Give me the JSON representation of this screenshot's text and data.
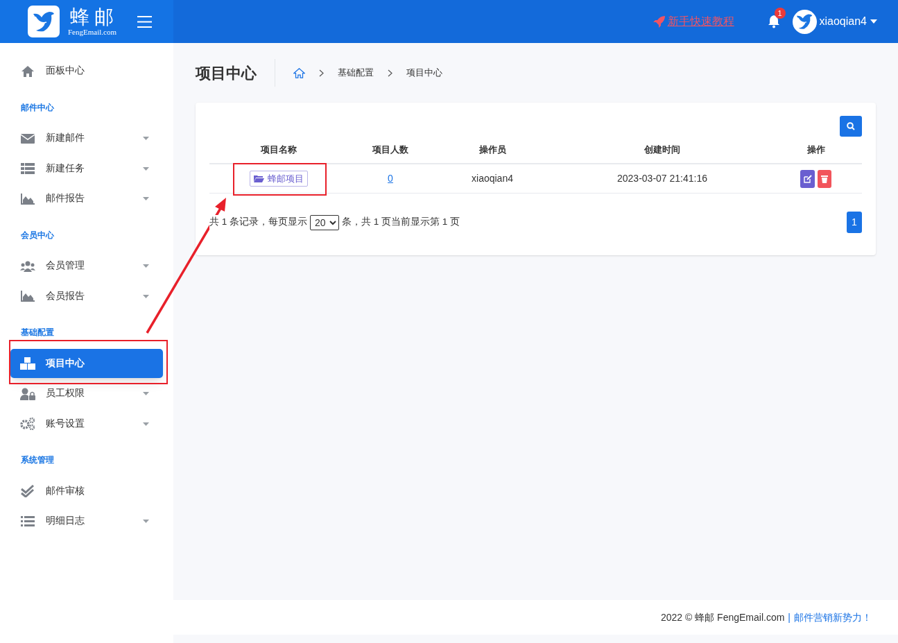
{
  "header": {
    "brand": "蜂 邮",
    "brand_sub": "FengEmail.com",
    "tutorial_link": "新手快速教程",
    "notification_count": "1",
    "username": "xiaoqian4"
  },
  "sidebar": [
    {
      "kind": "item",
      "label": "面板中心",
      "selected": false,
      "has_caret": false
    },
    {
      "kind": "section",
      "label": "邮件中心"
    },
    {
      "kind": "item",
      "label": "新建邮件",
      "selected": false,
      "has_caret": true
    },
    {
      "kind": "item",
      "label": "新建任务",
      "selected": false,
      "has_caret": true
    },
    {
      "kind": "item",
      "label": "邮件报告",
      "selected": false,
      "has_caret": true
    },
    {
      "kind": "section",
      "label": "会员中心"
    },
    {
      "kind": "item",
      "label": "会员管理",
      "selected": false,
      "has_caret": true
    },
    {
      "kind": "item",
      "label": "会员报告",
      "selected": false,
      "has_caret": true
    },
    {
      "kind": "section",
      "label": "基础配置"
    },
    {
      "kind": "item",
      "label": "项目中心",
      "selected": true,
      "has_caret": false
    },
    {
      "kind": "item",
      "label": "员工权限",
      "selected": false,
      "has_caret": true
    },
    {
      "kind": "item",
      "label": "账号设置",
      "selected": false,
      "has_caret": true
    },
    {
      "kind": "section",
      "label": "系统管理"
    },
    {
      "kind": "item",
      "label": "邮件审核",
      "selected": false,
      "has_caret": false
    },
    {
      "kind": "item",
      "label": "明细日志",
      "selected": false,
      "has_caret": true
    }
  ],
  "page_title": "项目中心",
  "breadcrumb": [
    "基础配置",
    "项目中心"
  ],
  "table": {
    "columns": [
      "项目名称",
      "项目人数",
      "操作员",
      "创建时间",
      "操作"
    ],
    "rows": [
      {
        "name": "蜂邮项目",
        "members": "0",
        "operator": "xiaoqian4",
        "created": "2023-03-07 21:41:16"
      }
    ]
  },
  "pagination": {
    "text_before": "共 1 条记录，每页显示",
    "page_size": "20",
    "text_after": "条，共 1 页当前显示第 1 页",
    "pages": [
      {
        "label": "1",
        "selected": true
      }
    ]
  },
  "footer": {
    "copyright": "2022 © 蜂邮 FengEmail.com",
    "separator": "|",
    "slogan": "邮件营销新势力！"
  }
}
